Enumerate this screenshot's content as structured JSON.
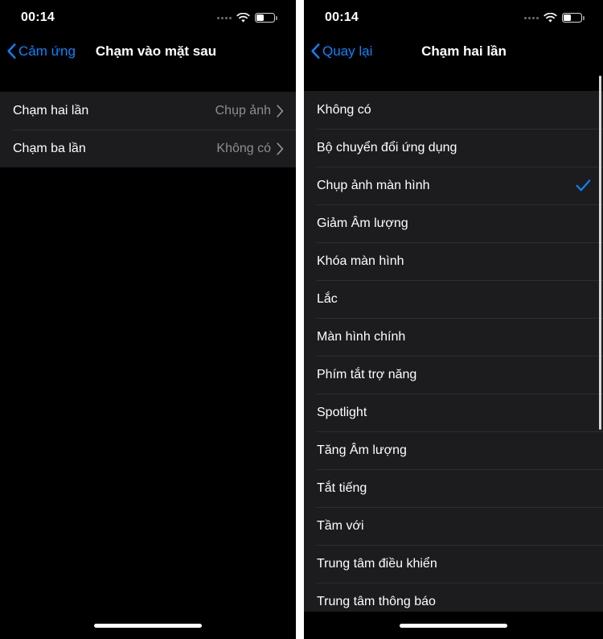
{
  "theme": {
    "accent": "#0a84ff",
    "background": "#000000",
    "row_background": "#1c1c1e",
    "separator": "#2e2e30",
    "secondary_text": "#8d8d92",
    "primary_text": "#ffffff"
  },
  "left_panel": {
    "status": {
      "time": "00:14",
      "signal_icon": "signal-dots-icon",
      "wifi_icon": "wifi-icon",
      "battery_icon": "battery-icon"
    },
    "nav": {
      "back_icon": "chevron-left-icon",
      "back_label": "Cảm ứng",
      "title": "Chạm vào mặt sau"
    },
    "rows": [
      {
        "label": "Chạm hai lần",
        "value": "Chụp ảnh",
        "chevron_icon": "chevron-right-icon"
      },
      {
        "label": "Chạm ba lần",
        "value": "Không có",
        "chevron_icon": "chevron-right-icon"
      }
    ],
    "home_indicator": "home-indicator"
  },
  "right_panel": {
    "status": {
      "time": "00:14",
      "signal_icon": "signal-dots-icon",
      "wifi_icon": "wifi-icon",
      "battery_icon": "battery-icon"
    },
    "nav": {
      "back_icon": "chevron-left-icon",
      "back_label": "Quay lại",
      "title": "Chạm hai lần"
    },
    "options": [
      {
        "label": "Không có",
        "selected": false
      },
      {
        "label": "Bộ chuyển đổi ứng dụng",
        "selected": false
      },
      {
        "label": "Chụp ảnh màn hình",
        "selected": true
      },
      {
        "label": "Giảm Âm lượng",
        "selected": false
      },
      {
        "label": "Khóa màn hình",
        "selected": false
      },
      {
        "label": "Lắc",
        "selected": false
      },
      {
        "label": "Màn hình chính",
        "selected": false
      },
      {
        "label": "Phím tắt trợ năng",
        "selected": false
      },
      {
        "label": "Spotlight",
        "selected": false
      },
      {
        "label": "Tăng Âm lượng",
        "selected": false
      },
      {
        "label": "Tắt tiếng",
        "selected": false
      },
      {
        "label": "Tầm với",
        "selected": false
      },
      {
        "label": "Trung tâm điều khiển",
        "selected": false
      },
      {
        "label": "Trung tâm thông báo",
        "selected": false
      }
    ],
    "check_icon": "checkmark-icon",
    "scrollbar": "vertical-scrollbar",
    "home_indicator": "home-indicator"
  }
}
